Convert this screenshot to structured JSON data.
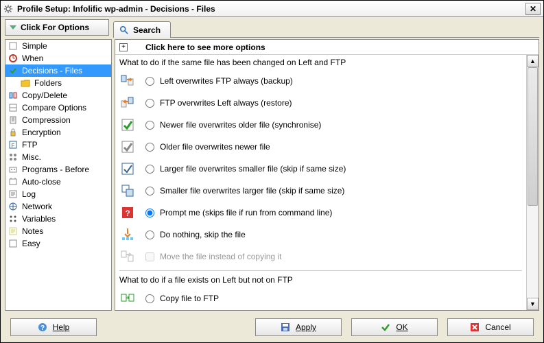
{
  "window": {
    "title": "Profile Setup: Infolific wp-admin - Decisions - Files"
  },
  "options_button": {
    "label": "Click For Options"
  },
  "tab": {
    "search": "Search"
  },
  "sidebar": {
    "items": [
      {
        "label": "Simple"
      },
      {
        "label": "When"
      },
      {
        "label": "Decisions - Files",
        "selected": true
      },
      {
        "label": "Folders",
        "indent": true
      },
      {
        "label": "Copy/Delete"
      },
      {
        "label": "Compare Options"
      },
      {
        "label": "Compression"
      },
      {
        "label": "Encryption"
      },
      {
        "label": "FTP"
      },
      {
        "label": "Misc."
      },
      {
        "label": "Programs - Before"
      },
      {
        "label": "Auto-close"
      },
      {
        "label": "Log"
      },
      {
        "label": "Network"
      },
      {
        "label": "Variables"
      },
      {
        "label": "Notes"
      },
      {
        "label": "Easy"
      }
    ]
  },
  "main": {
    "more_options": "Click here to see more options",
    "section1_title": "What to do if the same file has been changed on Left and FTP",
    "options1": [
      {
        "label": "Left overwrites FTP always (backup)",
        "checked": false
      },
      {
        "label": "FTP overwrites Left always (restore)",
        "checked": false
      },
      {
        "label": "Newer file overwrites older file (synchronise)",
        "checked": false
      },
      {
        "label": "Older file overwrites newer file",
        "checked": false
      },
      {
        "label": "Larger file overwrites smaller file (skip if same size)",
        "checked": false
      },
      {
        "label": "Smaller file overwrites larger file (skip if same size)",
        "checked": false
      },
      {
        "label": "Prompt me (skips file if run from command line)",
        "checked": true
      },
      {
        "label": "Do nothing, skip the file",
        "checked": false
      }
    ],
    "move_instead": {
      "label": "Move the file instead of copying it",
      "enabled": false,
      "checked": false
    },
    "section2_title": "What to do if a file exists on Left but not on FTP",
    "options2": [
      {
        "label": "Copy file to FTP",
        "checked": false
      }
    ]
  },
  "buttons": {
    "help": "Help",
    "apply": "Apply",
    "ok": "OK",
    "cancel": "Cancel"
  },
  "colors": {
    "selection": "#3399ff"
  }
}
